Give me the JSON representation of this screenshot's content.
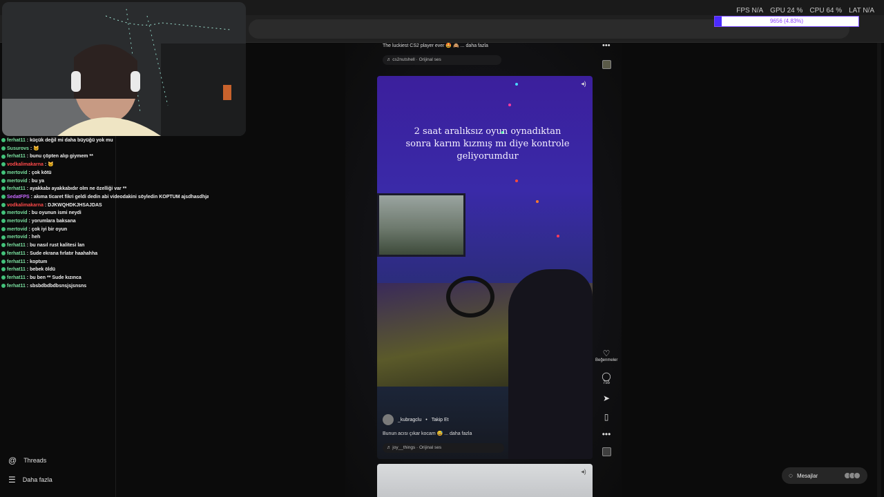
{
  "perf": {
    "fps_label": "FPS",
    "fps_value": "N/A",
    "gpu_label": "GPU",
    "gpu_value": "24 %",
    "cpu_label": "CPU",
    "cpu_value": "64 %",
    "lat_label": "LAT",
    "lat_value": "N/A",
    "bar_text": "9656 (4.83%)",
    "bar_fraction": 0.0483
  },
  "chat": [
    {
      "user": "ferhat11",
      "color": "green",
      "text": "küçük değil mi daha büyüğü yok mu"
    },
    {
      "user": "Susurovs",
      "color": "green",
      "text": "🐱"
    },
    {
      "user": "ferhat11",
      "color": "green",
      "text": "bunu çöpten alıp giymem **"
    },
    {
      "user": "vodkalimakarna",
      "color": "red",
      "text": "🐱"
    },
    {
      "user": "mertovid",
      "color": "green",
      "text": "çok kötü"
    },
    {
      "user": "mertovid",
      "color": "green",
      "text": "bu ya"
    },
    {
      "user": "ferhat11",
      "color": "green",
      "text": "ayakkabı ayakkabıdır olm ne özelliği var **"
    },
    {
      "user": "SedatFPS",
      "color": "pur",
      "text": "akıma ticaret fikri geldi dedin abi videodakini söyledin KOPTUM ajsdhasdhjashdjashdasd"
    },
    {
      "user": "vodkalimakarna",
      "color": "red",
      "text": "DJKWQHDKJHSAJDAS"
    },
    {
      "user": "mertovid",
      "color": "green",
      "text": "bu oyunun ismi neydi"
    },
    {
      "user": "mertovid",
      "color": "green",
      "text": "yorumlara baksana"
    },
    {
      "user": "mertovid",
      "color": "green",
      "text": "çok iyi bir oyun"
    },
    {
      "user": "mertovid",
      "color": "green",
      "text": "heh"
    },
    {
      "user": "ferhat11",
      "color": "green",
      "text": "bu nasıl rust kalitesi lan"
    },
    {
      "user": "ferhat11",
      "color": "green",
      "text": "Sude ekrana fırlatır haahahha"
    },
    {
      "user": "ferhat11",
      "color": "green",
      "text": "koptum"
    },
    {
      "user": "ferhat11",
      "color": "green",
      "text": "bebek öldü"
    },
    {
      "user": "ferhat11",
      "color": "green",
      "text": "bu ben ** Sude kızınca"
    },
    {
      "user": "ferhat11",
      "color": "green",
      "text": "sbsbdbdbdbsnsjsjsnsns"
    }
  ],
  "sidebar": {
    "threads_label": "Threads",
    "more_label": "Daha fazla"
  },
  "post_top": {
    "caption": "The luckiest CS2 player ever 🤩 🙈 ... daha fazla",
    "music": "♬ cs2nutshell · Orijinal ses"
  },
  "video": {
    "overlay_text": "2 saat aralıksız oyun oynadıktan sonra karım kızmış mı diye kontrole geliyorumdur"
  },
  "post": {
    "author": "_kubragclu",
    "follow_label": "Takip Et",
    "caption": "Bunun acısı çıkar kocam 😅 ... daha fazla",
    "music": "♬ joy__things · Orijinal ses"
  },
  "actions": {
    "like_label": "Beğenmeler",
    "comment_count": "755"
  },
  "messages": {
    "label": "Mesajlar"
  }
}
